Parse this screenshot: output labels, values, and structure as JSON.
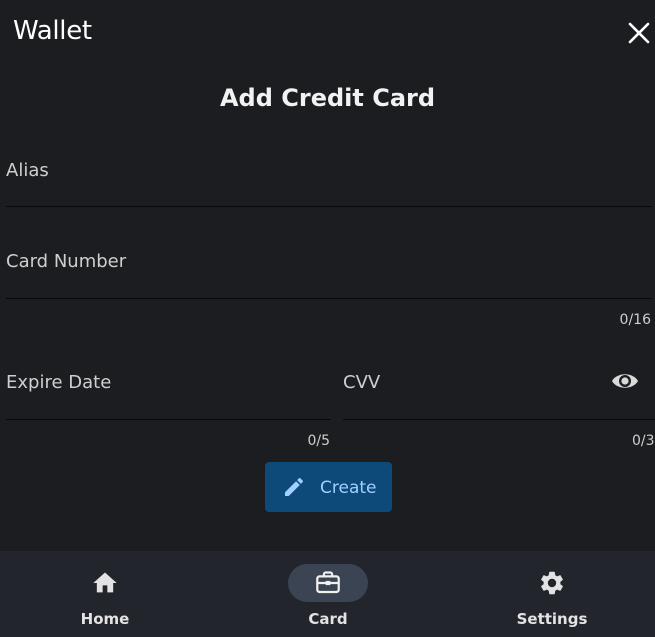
{
  "app": {
    "title": "Wallet"
  },
  "page": {
    "title": "Add Credit Card"
  },
  "form": {
    "alias": {
      "label": "Alias",
      "value": ""
    },
    "card_number": {
      "label": "Card Number",
      "value": "",
      "counter": "0/16"
    },
    "expire_date": {
      "label": "Expire Date",
      "value": "",
      "counter": "0/5"
    },
    "cvv": {
      "label": "CVV",
      "value": "",
      "counter": "0/3"
    },
    "create_label": "Create"
  },
  "nav": {
    "items": [
      {
        "label": "Home",
        "icon": "home-icon",
        "active": false
      },
      {
        "label": "Card",
        "icon": "briefcase-icon",
        "active": true
      },
      {
        "label": "Settings",
        "icon": "gear-icon",
        "active": false
      }
    ]
  },
  "colors": {
    "background": "#1c1d20",
    "nav_background": "#22252c",
    "active_pill": "#3a4452",
    "button_background": "#0d4a7a",
    "button_text": "#9fd0ff"
  }
}
